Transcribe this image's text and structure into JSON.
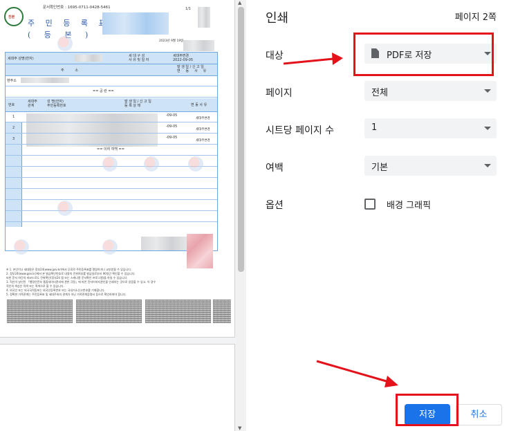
{
  "preview": {
    "doc_number": "문서확인번호 : 1695-0711-0428-5461",
    "page_count": "1/1",
    "stamp_text": "진본",
    "title": "주 민 등 록 표",
    "subtitle": "( 등    본 )",
    "date": "2023년 9월 19일",
    "table": {
      "head_row1_left": "세대주 성명(한자)",
      "head_row1_mid": "세 대 구 성\n사 유 및 일 자",
      "head_row1_right": "세대주변경\n2022-09-05",
      "head_row2_mid": "주          소",
      "head_row2_right": "발 생 일 / 신 고 일\n변     동     사     유",
      "addr_label": "현주소",
      "section_title": "== 공  란 ==",
      "col_number": "번호",
      "col_relation": "세대주\n관계",
      "col_name": "성 명(한자)\n주민등록번호",
      "col_date": "발 생 일 / 신 고 일\n등 록 상 태",
      "col_reason": "변 동 사 유",
      "rows": [
        {
          "num": "1",
          "date": "-09-05",
          "reason": "세대주변경"
        },
        {
          "num": "2",
          "date": "-09-05",
          "reason": "세대주변경"
        },
        {
          "num": "3",
          "date": "-09-05",
          "reason": "세대주변경"
        }
      ],
      "end_text": "== 이하 여백 =="
    },
    "footnotes": [
      "※ 1. 본인이나 세대원은 정부24(www.gov.kr)에서 무료로 주민등록표를 열람하거나 교부받을 수 있습니다.",
      "   2. 정부24(www.gov.kr)에서 본 발급확인번호로 내용의 진위여부를 발급일로부터 90일간 확인할 수 있습니다.",
      "      또한 문서 하단의 바코드로도 진위확인(정부24 앱 또는 스캐너용 문서확인 프로그램)을 하실 수 있습니다.",
      "   3. 직인이 날인된 「행정안전부 통합데이터관리에 관한 규정」에 따른 전자이미지관인을 인쇄하는 것으로 갈음할 수 있고, 이 경우",
      "      직인의 색상은 적색 또는 흑색으로 할 수 있습니다.",
      "   4. 외국인 또는 외국국적동포는 외국인등록번호 또는 국내거소신고번호를 기재합니다.",
      "   5. 정확한 가족관계는 주민등록표 및 세대주와의 관계가 아닌 가족관계증명서 등으로 확인하여야 합니다."
    ]
  },
  "panel": {
    "title": "인쇄",
    "pages_info": "페이지 2쪽",
    "destination_label": "대상",
    "destination_value": "PDF로 저장",
    "pages_label": "페이지",
    "pages_value": "전체",
    "per_sheet_label": "시트당 페이지 수",
    "per_sheet_value": "1",
    "margins_label": "여백",
    "margins_value": "기본",
    "options_label": "옵션",
    "background_graphics_label": "배경 그래픽",
    "background_graphics_checked": false,
    "save_label": "저장",
    "cancel_label": "취소"
  },
  "colors": {
    "primary_blue": "#1a73e8",
    "annotation_red": "#e4121a",
    "doc_blue": "#2b5aa8"
  }
}
